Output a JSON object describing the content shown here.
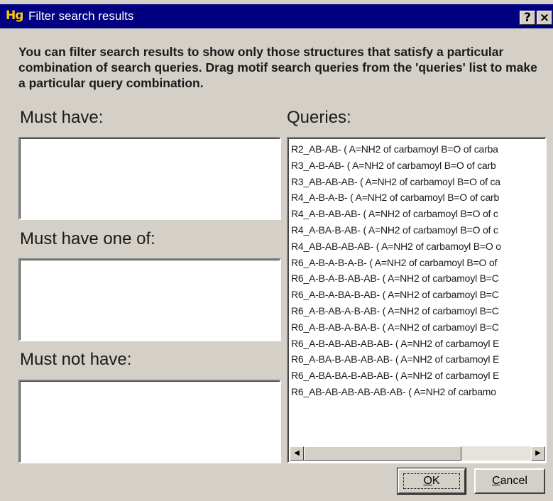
{
  "window": {
    "icon_text": "Hg",
    "title": "Filter search results",
    "help_glyph": "?",
    "close_glyph": "×"
  },
  "instructions": "You can filter search results to show only those structures that satisfy a particular combination of search queries. Drag motif search queries from the 'queries' list to make a particular query combination.",
  "sections": {
    "must_have": "Must have:",
    "must_have_one_of": "Must have one of:",
    "must_not_have": "Must not have:",
    "queries": "Queries:"
  },
  "queries": [
    "R2_AB-AB- ( A=NH2 of carbamoyl B=O of carba",
    "R3_A-B-AB- ( A=NH2 of carbamoyl B=O of carb",
    "R3_AB-AB-AB- ( A=NH2 of carbamoyl B=O of ca",
    "R4_A-B-A-B- ( A=NH2 of carbamoyl B=O of carb",
    "R4_A-B-AB-AB- ( A=NH2 of carbamoyl B=O of c",
    "R4_A-BA-B-AB- ( A=NH2 of carbamoyl B=O of c",
    "R4_AB-AB-AB-AB- ( A=NH2 of carbamoyl B=O o",
    "R6_A-B-A-B-A-B- ( A=NH2 of carbamoyl B=O of",
    "R6_A-B-A-B-AB-AB- ( A=NH2 of carbamoyl B=C",
    "R6_A-B-A-BA-B-AB- ( A=NH2 of carbamoyl B=C",
    "R6_A-B-AB-A-B-AB- ( A=NH2 of carbamoyl B=C",
    "R6_A-B-AB-A-BA-B- ( A=NH2 of carbamoyl B=C",
    "R6_A-B-AB-AB-AB-AB- ( A=NH2 of carbamoyl E",
    "R6_A-BA-B-AB-AB-AB- ( A=NH2 of carbamoyl E",
    "R6_A-BA-BA-B-AB-AB- ( A=NH2 of carbamoyl E",
    "R6_AB-AB-AB-AB-AB-AB- ( A=NH2 of carbamo"
  ],
  "scrollbar": {
    "left_arrow": "◀",
    "right_arrow": "▶"
  },
  "buttons": {
    "ok": {
      "mnemonic": "O",
      "rest": "K"
    },
    "cancel": {
      "mnemonic": "C",
      "rest": "ancel"
    }
  },
  "colors": {
    "titlebar": "#000080",
    "dialog_bg": "#d4d0c8",
    "icon_text": "#ffcc00"
  }
}
